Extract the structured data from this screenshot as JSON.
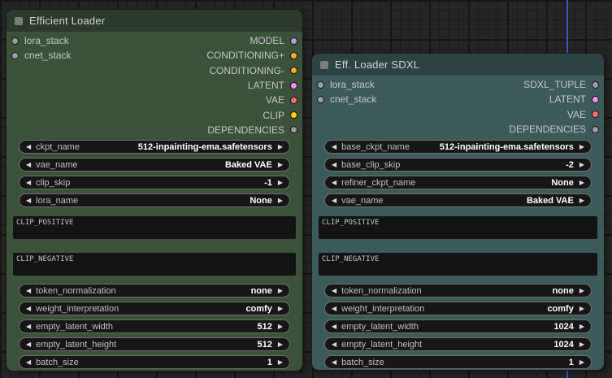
{
  "canvas": {
    "link_color": "#3d56cc"
  },
  "nodes": [
    {
      "title": "Efficient Loader",
      "colors": {
        "header": "#2b3a2a",
        "body": "#3b513a"
      },
      "inputs": [
        {
          "name": "lora_stack",
          "color": "#9d9daa"
        },
        {
          "name": "cnet_stack",
          "color": "#9d9daa"
        }
      ],
      "outputs": [
        {
          "name": "MODEL",
          "color": "#b39ddb"
        },
        {
          "name": "CONDITIONING+",
          "color": "#ffa931"
        },
        {
          "name": "CONDITIONING-",
          "color": "#ffa931"
        },
        {
          "name": "LATENT",
          "color": "#ff8ff9"
        },
        {
          "name": "VAE",
          "color": "#ff6e6e"
        },
        {
          "name": "CLIP",
          "color": "#ffd500"
        },
        {
          "name": "DEPENDENCIES",
          "color": "#9d9daa"
        }
      ],
      "combos_top": [
        {
          "label": "ckpt_name",
          "value": "512-inpainting-ema.safetensors"
        },
        {
          "label": "vae_name",
          "value": "Baked VAE"
        },
        {
          "label": "clip_skip",
          "value": "-1"
        },
        {
          "label": "lora_name",
          "value": "None"
        }
      ],
      "prompts": [
        {
          "value": "CLIP_POSITIVE"
        },
        {
          "value": "CLIP_NEGATIVE"
        }
      ],
      "combos_bottom": [
        {
          "label": "token_normalization",
          "value": "none"
        },
        {
          "label": "weight_interpretation",
          "value": "comfy"
        },
        {
          "label": "empty_latent_width",
          "value": "512"
        },
        {
          "label": "empty_latent_height",
          "value": "512"
        },
        {
          "label": "batch_size",
          "value": "1"
        }
      ]
    },
    {
      "title": "Eff. Loader SDXL",
      "colors": {
        "header": "#2c4343",
        "body": "#3c5a5a"
      },
      "inputs": [
        {
          "name": "lora_stack",
          "color": "#9d9daa"
        },
        {
          "name": "cnet_stack",
          "color": "#9d9daa"
        }
      ],
      "outputs": [
        {
          "name": "SDXL_TUPLE",
          "color": "#9d9daa"
        },
        {
          "name": "LATENT",
          "color": "#ff8ff9"
        },
        {
          "name": "VAE",
          "color": "#ff6e6e"
        },
        {
          "name": "DEPENDENCIES",
          "color": "#9d9daa"
        }
      ],
      "combos_top": [
        {
          "label": "base_ckpt_name",
          "value": "512-inpainting-ema.safetensors"
        },
        {
          "label": "base_clip_skip",
          "value": "-2"
        },
        {
          "label": "refiner_ckpt_name",
          "value": "None"
        },
        {
          "label": "vae_name",
          "value": "Baked VAE"
        }
      ],
      "prompts": [
        {
          "value": "CLIP_POSITIVE"
        },
        {
          "value": "CLIP_NEGATIVE"
        }
      ],
      "combos_bottom": [
        {
          "label": "token_normalization",
          "value": "none"
        },
        {
          "label": "weight_interpretation",
          "value": "comfy"
        },
        {
          "label": "empty_latent_width",
          "value": "1024"
        },
        {
          "label": "empty_latent_height",
          "value": "1024"
        },
        {
          "label": "batch_size",
          "value": "1"
        }
      ]
    }
  ]
}
